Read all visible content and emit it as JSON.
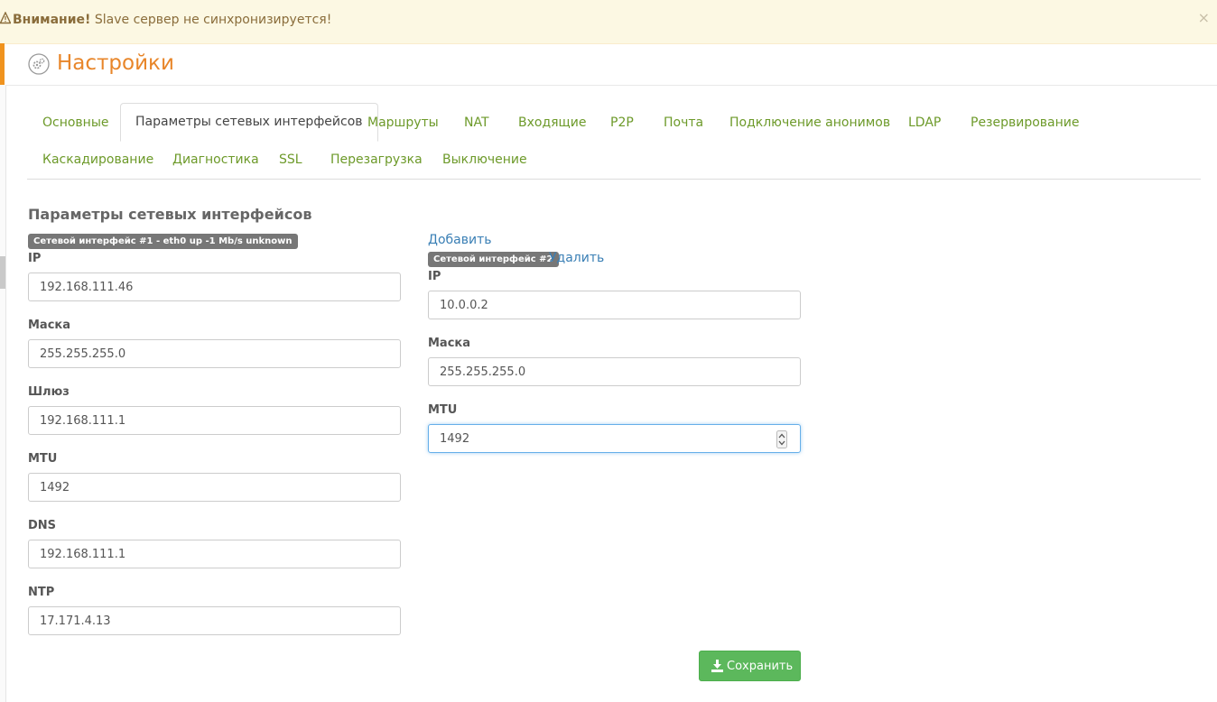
{
  "alert": {
    "strong": "Внимание!",
    "message": "Slave сервер не синхронизируется!",
    "close": "×",
    "icon": "warning-icon"
  },
  "header": {
    "title": "Настройки",
    "icon": "settings-gear-icon"
  },
  "tabs": [
    "Основные",
    "Параметры сетевых интерфейсов",
    "Маршруты",
    "NAT",
    "Входящие",
    "P2P",
    "Почта",
    "Подключение анонимов",
    "LDAP",
    "Резервирование",
    "Каскадирование",
    "Диагностика",
    "SSL",
    "Перезагрузка",
    "Выключение"
  ],
  "active_tab": "Параметры сетевых интерфейсов",
  "section_title": "Параметры сетевых интерфейсов",
  "iface1": {
    "badge": "Сетевой интерфейс #1 - eth0 up -1 Mb/s unknown",
    "fields": [
      {
        "label": "IP",
        "value": "192.168.111.46"
      },
      {
        "label": "Маска",
        "value": "255.255.255.0"
      },
      {
        "label": "Шлюз",
        "value": "192.168.111.1"
      },
      {
        "label": "MTU",
        "value": "1492"
      },
      {
        "label": "DNS",
        "value": "192.168.111.1"
      },
      {
        "label": "NTP",
        "value": "17.171.4.13"
      }
    ]
  },
  "iface2": {
    "add_link": "Добавить",
    "badge": "Сетевой интерфейс #2",
    "delete_link": "Удалить",
    "fields": [
      {
        "label": "IP",
        "value": "10.0.0.2"
      },
      {
        "label": "Маска",
        "value": "255.255.255.0"
      },
      {
        "label": "MTU",
        "value": "1492"
      }
    ]
  },
  "save_button": {
    "label": "Сохранить",
    "icon": "download-icon"
  },
  "colors": {
    "accent": "#e8862a",
    "tab_link": "#6d9a2a",
    "link": "#3a7fb5",
    "save": "#5cb85c",
    "alert_bg": "#fcf8e3"
  }
}
